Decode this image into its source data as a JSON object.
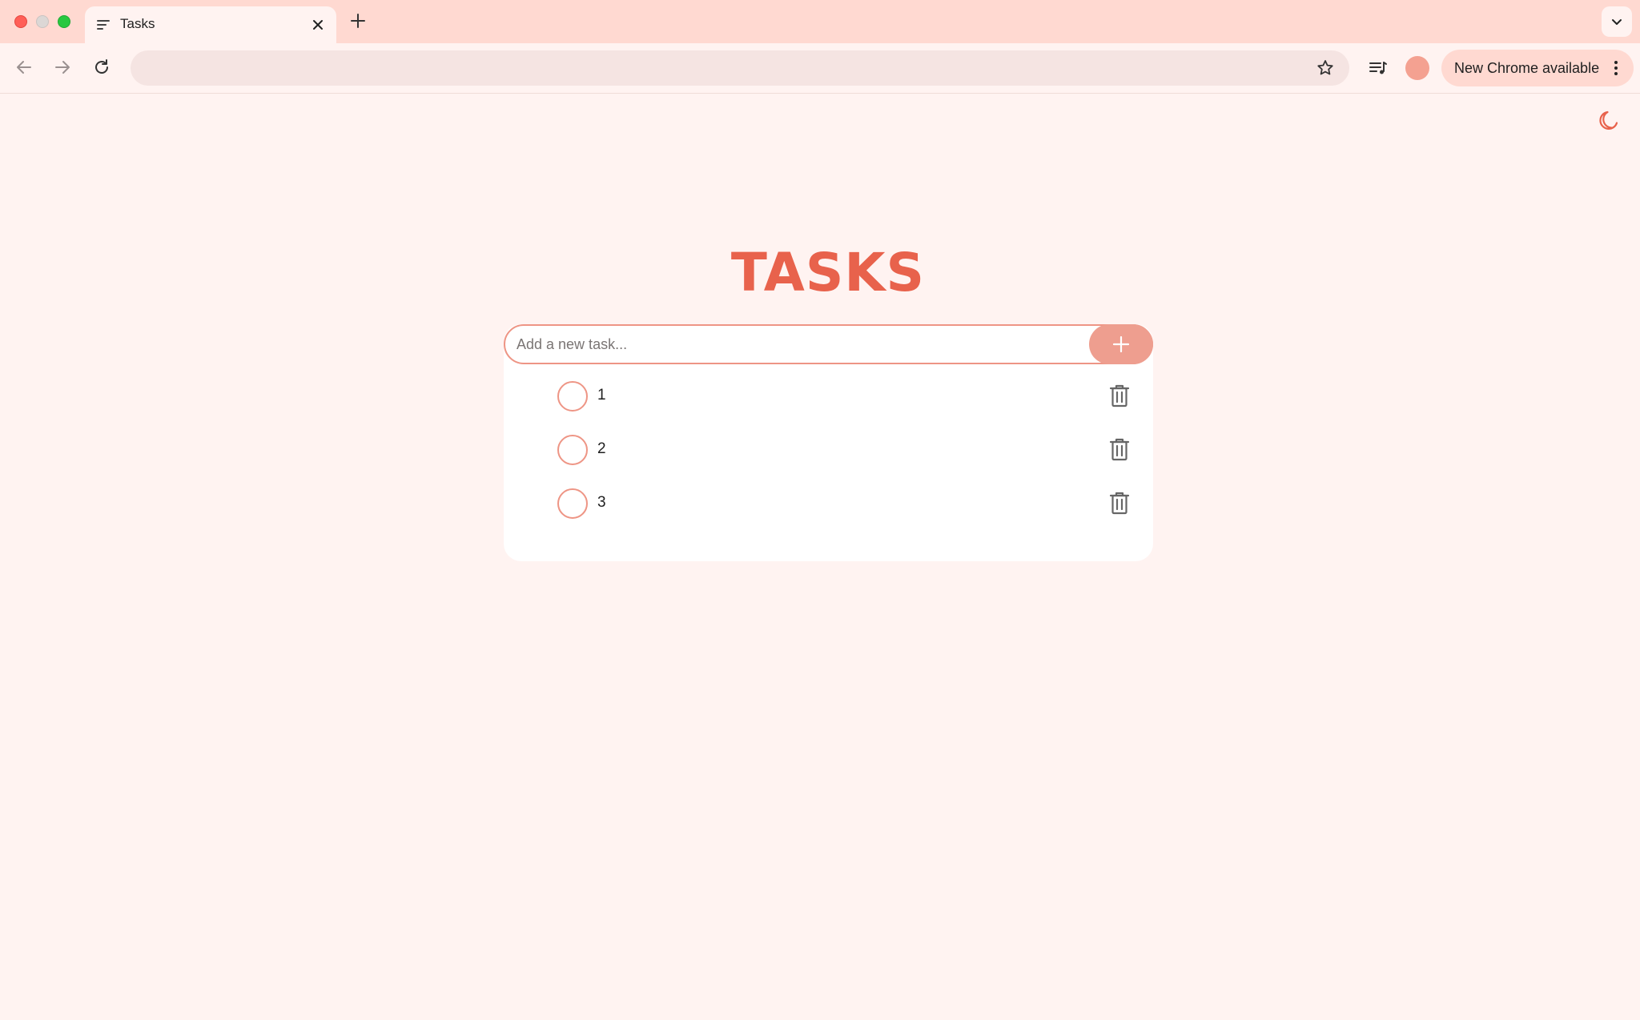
{
  "browser": {
    "tab_title": "Tasks",
    "omnibox_value": "",
    "update_chip_label": "New Chrome available",
    "accent_color": "#e8624c"
  },
  "app": {
    "title": "TASKS",
    "input_placeholder": "Add a new task...",
    "input_value": ""
  },
  "tasks": [
    {
      "text": "1",
      "completed": false
    },
    {
      "text": "2",
      "completed": false
    },
    {
      "text": "3",
      "completed": false
    }
  ],
  "icons": {
    "tab_icon": "sort-lines-icon",
    "close": "close-icon",
    "new_tab": "plus-icon",
    "tab_search": "chevron-down-icon",
    "back": "arrow-left-icon",
    "forward": "arrow-right-icon",
    "reload": "reload-icon",
    "bookmark": "star-icon",
    "media": "media-queue-icon",
    "menu": "three-dots-vertical-icon",
    "theme": "moon-icon",
    "add": "plus-icon",
    "delete": "trash-icon",
    "check": "circle-outline-icon"
  }
}
